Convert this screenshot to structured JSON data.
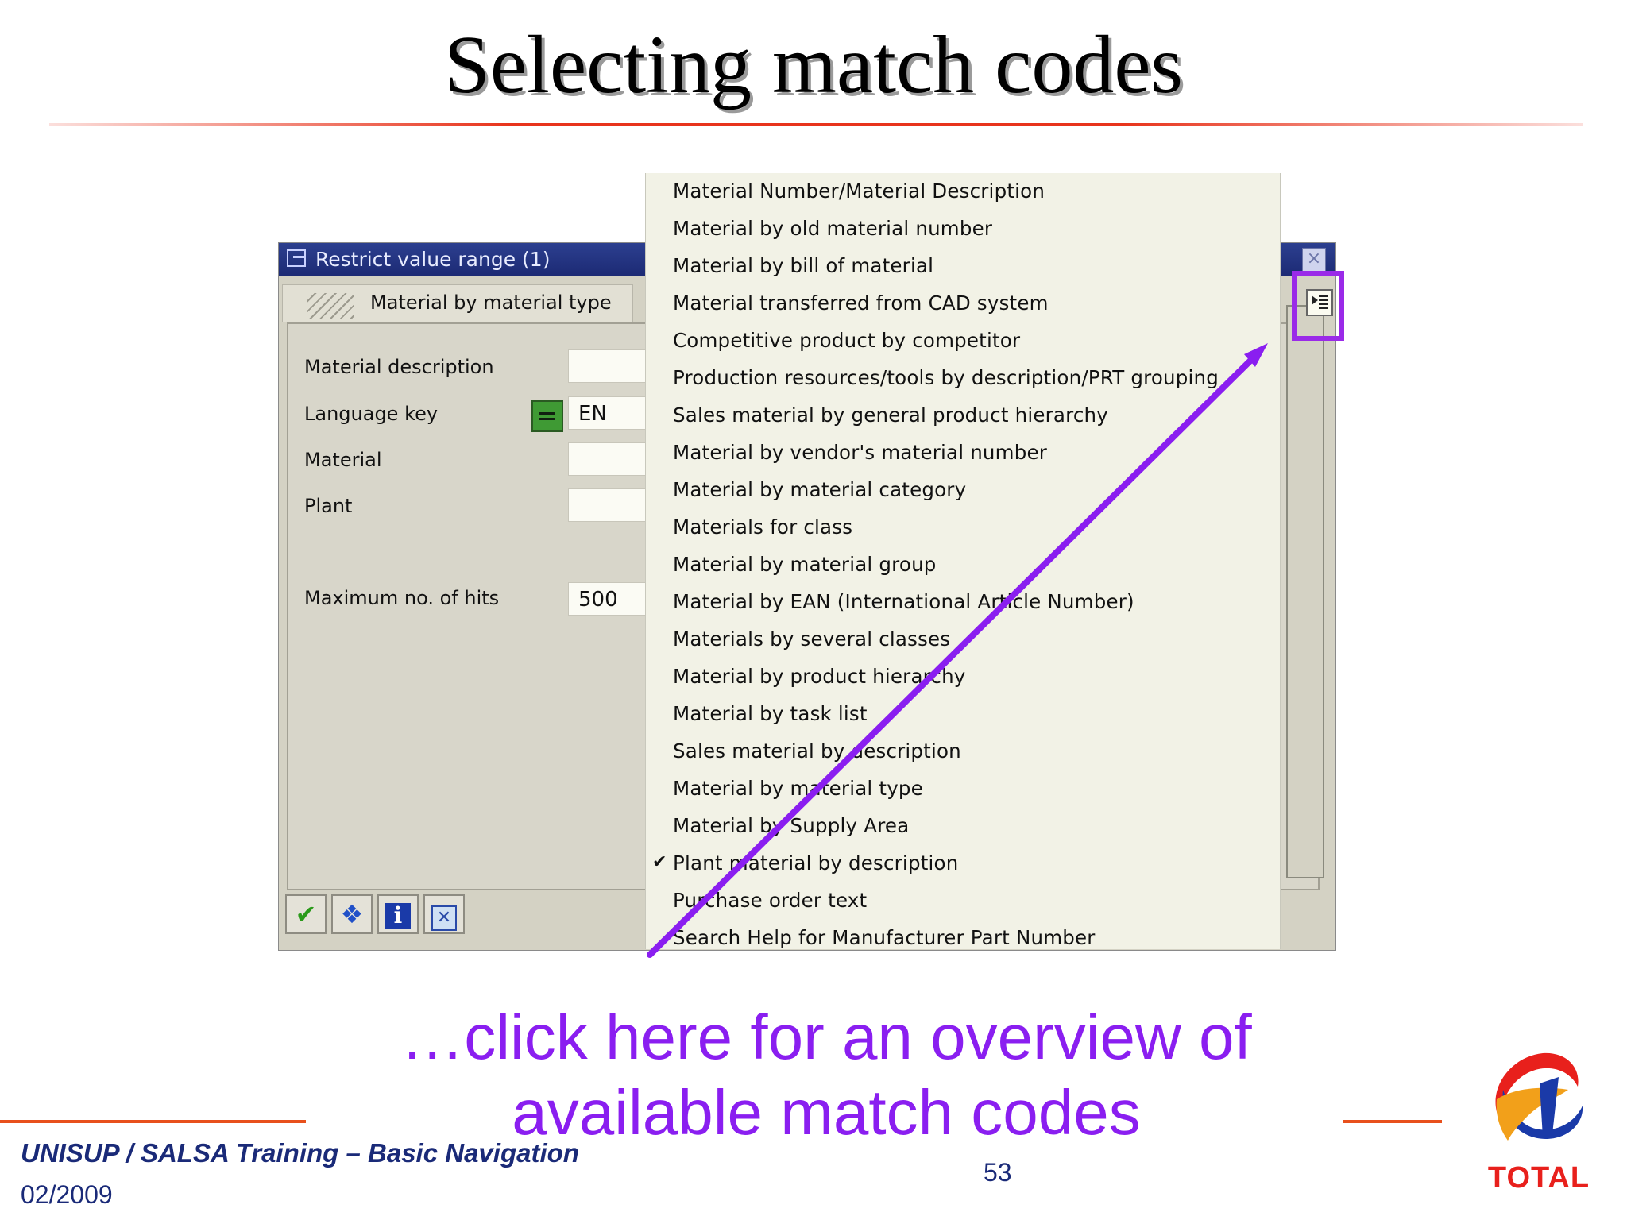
{
  "slide": {
    "title": "Selecting match codes",
    "caption_line1": "…click here for an overview of",
    "caption_line2": "available match codes",
    "footer_course": "UNISUP / SALSA Training – Basic Navigation",
    "footer_date": "02/2009",
    "page_number": "53",
    "logo_text": "TOTAL"
  },
  "dialog": {
    "title": "Restrict value range (1)",
    "active_tab": "Material by material type",
    "fields": [
      {
        "label": "Material description",
        "value": ""
      },
      {
        "label": "Language key",
        "value": "EN"
      },
      {
        "label": "Material",
        "value": ""
      },
      {
        "label": "Plant",
        "value": ""
      },
      {
        "label": "Maximum no. of hits",
        "value": "500"
      }
    ],
    "toolbar": [
      "ok-icon",
      "find-icon",
      "info-icon",
      "cancel-icon"
    ]
  },
  "match_code_list": {
    "items": [
      "Material Number/Material Description",
      "Material by old material number",
      "Material by bill of material",
      "Material transferred from CAD system",
      "Competitive product by competitor",
      "Production resources/tools by description/PRT grouping",
      "Sales material by general product hierarchy",
      "Material by vendor's material number",
      "Material by material category",
      "Materials for class",
      "Material by material group",
      "Material by EAN (International Article Number)",
      "Materials by several classes",
      "Material by product hierarchy",
      "Material by task list",
      "Sales material by description",
      "Material by material type",
      "Material by Supply Area",
      "Plant material by description",
      "Purchase order text",
      "Search Help for Manufacturer Part Number"
    ],
    "checked_item": "Plant material by description"
  },
  "colors": {
    "accent_purple": "#8a1ef0",
    "title_rule": "#e8341c",
    "dialog_title_bar": "#1c2a74",
    "footer_text": "#1a2a78"
  }
}
